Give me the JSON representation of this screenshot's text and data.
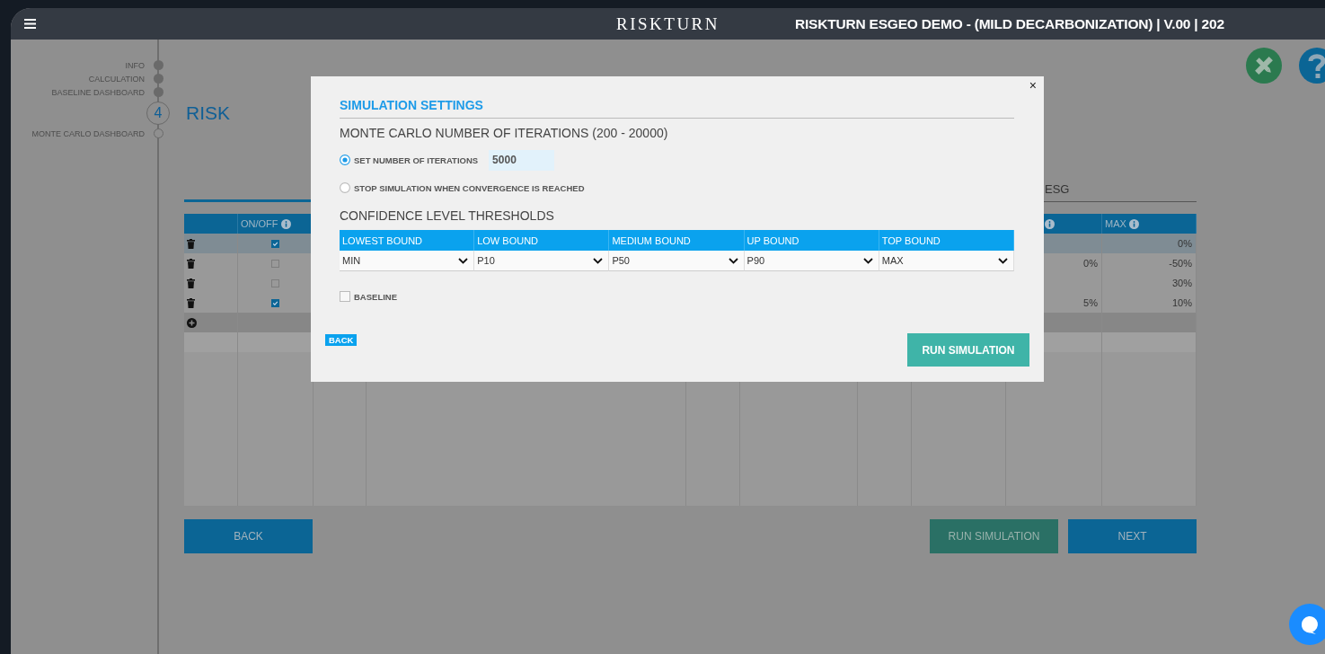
{
  "header": {
    "logo": "RISKTURN",
    "title": "RISKTURN ESGEO DEMO - (MILD DECARBONIZATION) | V.00 | 202"
  },
  "steps": [
    {
      "kind": "dot",
      "label": "INFO",
      "completed": true
    },
    {
      "kind": "dot",
      "label": "CALCULATION",
      "completed": true
    },
    {
      "kind": "dot",
      "label": "BASELINE DASHBOARD",
      "completed": true
    },
    {
      "kind": "number",
      "number": "4"
    },
    {
      "kind": "dot",
      "label": "MONTE CARLO DASHBOARD",
      "completed": false
    }
  ],
  "page_title": "RISK",
  "tabs": [
    {
      "label": "ESG",
      "selected": false
    }
  ],
  "table": {
    "columns": [
      {
        "info": false
      },
      {
        "label": "ON/OFF",
        "info": true
      },
      {},
      {},
      {},
      {},
      {},
      {},
      {
        "info": true
      },
      {
        "label": "MAX",
        "info": true
      }
    ],
    "rows": [
      {
        "selected": true,
        "on": true,
        "max": "0%"
      },
      {
        "selected": false,
        "on": false,
        "column_9": "0%",
        "max": "-50%"
      },
      {
        "selected": false,
        "on": false,
        "max": "30%"
      },
      {
        "selected": false,
        "on": true,
        "column_9": "5%",
        "max": "10%"
      }
    ]
  },
  "buttons": [
    {
      "label": "BACK",
      "kind": "nav"
    },
    {
      "label": "RUN SIMULATION",
      "kind": "run"
    },
    {
      "label": "NEXT",
      "kind": "nav"
    }
  ],
  "modal": {
    "close": "×",
    "title": "SIMULATION SETTINGS",
    "iterations_heading": "MONTE CARLO NUMBER OF ITERATIONS (200 - 20000)",
    "options": [
      {
        "label": "SET NUMBER OF ITERATIONS",
        "selected": true,
        "value": "5000"
      },
      {
        "label": "STOP SIMULATION WHEN CONVERGENCE IS REACHED",
        "selected": false
      }
    ],
    "thresholds_heading": "CONFIDENCE LEVEL THRESHOLDS",
    "thresholds": [
      {
        "label": "LOWEST BOUND",
        "value": "MIN"
      },
      {
        "label": "LOW BOUND",
        "value": "P10"
      },
      {
        "label": "MEDIUM BOUND",
        "value": "P50"
      },
      {
        "label": "UP BOUND",
        "value": "P90"
      },
      {
        "label": "TOP BOUND",
        "value": "MAX"
      }
    ],
    "baseline": {
      "label": "BASELINE",
      "checked": false
    },
    "back_button": "BACK",
    "run_button": "RUN SIMULATION"
  }
}
